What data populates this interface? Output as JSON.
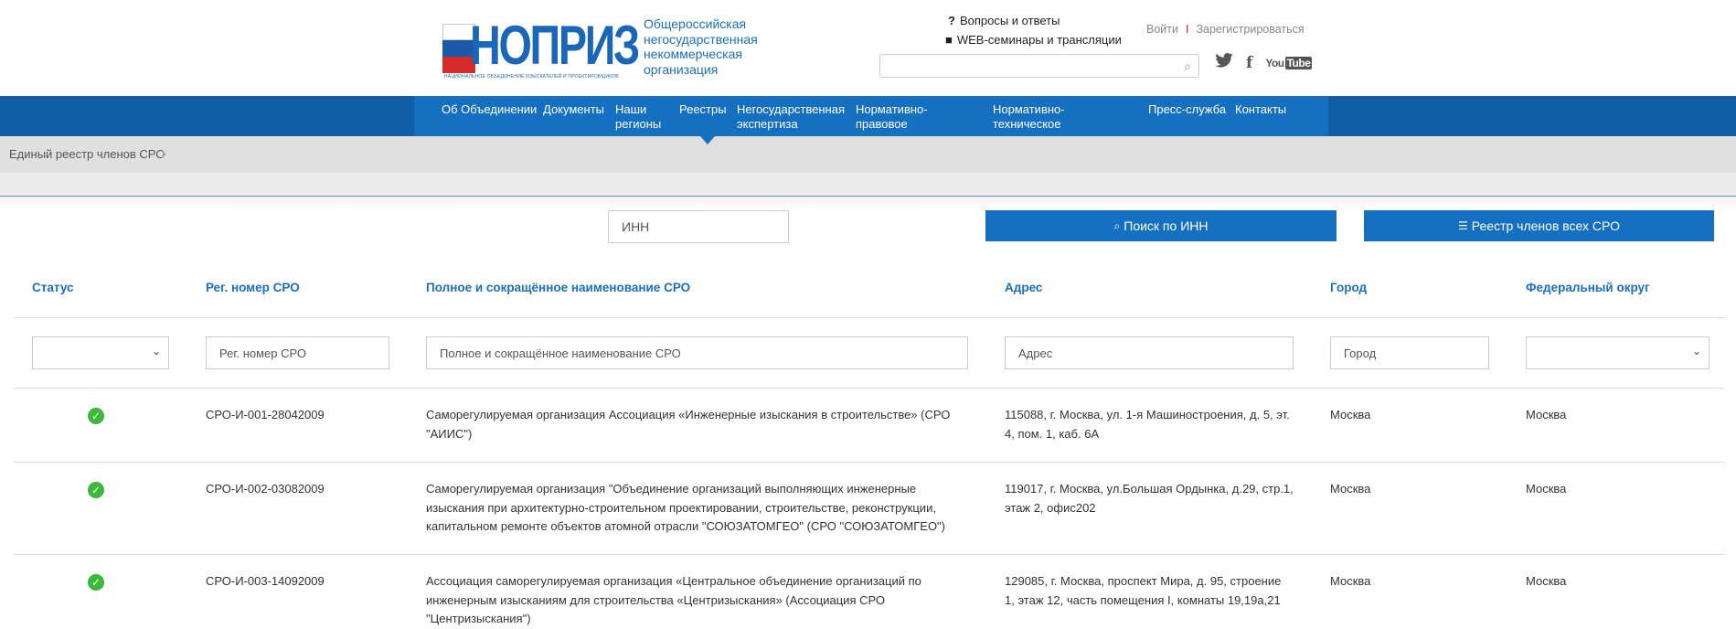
{
  "logo": {
    "word": "НОПРИЗ",
    "sub": "НАЦИОНАЛЬНОЕ ОБЪЕДИНЕНИЕ ИЗЫСКАТЕЛЕЙ И ПРОЕКТИРОВЩИКОВ"
  },
  "tagline": "Общероссийская негосударственная некоммерческая организация",
  "header_links": {
    "qa": "Вопросы и ответы",
    "web": "WEB-семинары и трансляции"
  },
  "auth": {
    "login": "Войти",
    "sep": "I",
    "register": "Зарегистрироваться"
  },
  "social": {
    "twitter": "twitter-icon",
    "facebook": "f",
    "youtube_a": "You",
    "youtube_b": "Tube"
  },
  "nav": [
    "Об Объединении",
    "Документы",
    "Наши регионы",
    "Реестры",
    "Негосударственная экспертиза",
    "Нормативно-правовое регулирование",
    "Нормативно-техническое регулирование",
    "Пресс-служба",
    "Контакты"
  ],
  "breadcrumb": "Единый реестр членов СРО",
  "controls": {
    "inn_placeholder": "ИНН",
    "search_btn": "Поиск по ИНН",
    "all_btn": "Реестр членов всех СРО"
  },
  "table": {
    "headers": [
      "Статус",
      "Рег. номер СРО",
      "Полное и сокращённое наименование СРО",
      "Адрес",
      "Город",
      "Федеральный округ"
    ],
    "filters": {
      "reg": "Рег. номер СРО",
      "name": "Полное и сокращённое наименование СРО",
      "address": "Адрес",
      "city": "Город"
    },
    "rows": [
      {
        "status": "active",
        "reg": "СРО-И-001-28042009",
        "name_lines": [
          "Саморегулируемая организация Ассоциация «Инженерные изыскания в строительстве» (СРО",
          "\"АИИС\")"
        ],
        "addr_lines": [
          "115088, г. Москва, ул. 1-я Машиностроения, д. 5, эт.",
          "4, пом. 1, каб. 6А"
        ],
        "city": "Москва",
        "district": "Москва"
      },
      {
        "status": "active",
        "reg": "СРО-И-002-03082009",
        "name_lines": [
          "Саморегулируемая организация \"Объединение организаций выполняющих инженерные",
          "изыскания при архитектурно-строительном проектировании, строительстве, реконструкции,",
          "капитальном ремонте объектов атомной отрасли \"СОЮЗАТОМГЕО\" (СРО \"СОЮЗАТОМГЕО\")"
        ],
        "addr_lines": [
          "119017, г. Москва, ул.Большая Ордынка, д.29, стр.1,",
          "этаж 2, офис202"
        ],
        "city": "Москва",
        "district": "Москва"
      },
      {
        "status": "active",
        "reg": "СРО-И-003-14092009",
        "name_lines": [
          "Ассоциация саморегулируемая организация «Центральное объединение организаций по",
          "инженерным изысканиям для строительства «Центризыскания» (Ассоциация СРО",
          "\"Центризыскания\")"
        ],
        "addr_lines": [
          "129085, г. Москва, проспект Мира, д. 95, строение",
          "1, этаж 12, часть помещения I, комнаты 19,19а,21"
        ],
        "city": "Москва",
        "district": "Москва"
      }
    ]
  }
}
